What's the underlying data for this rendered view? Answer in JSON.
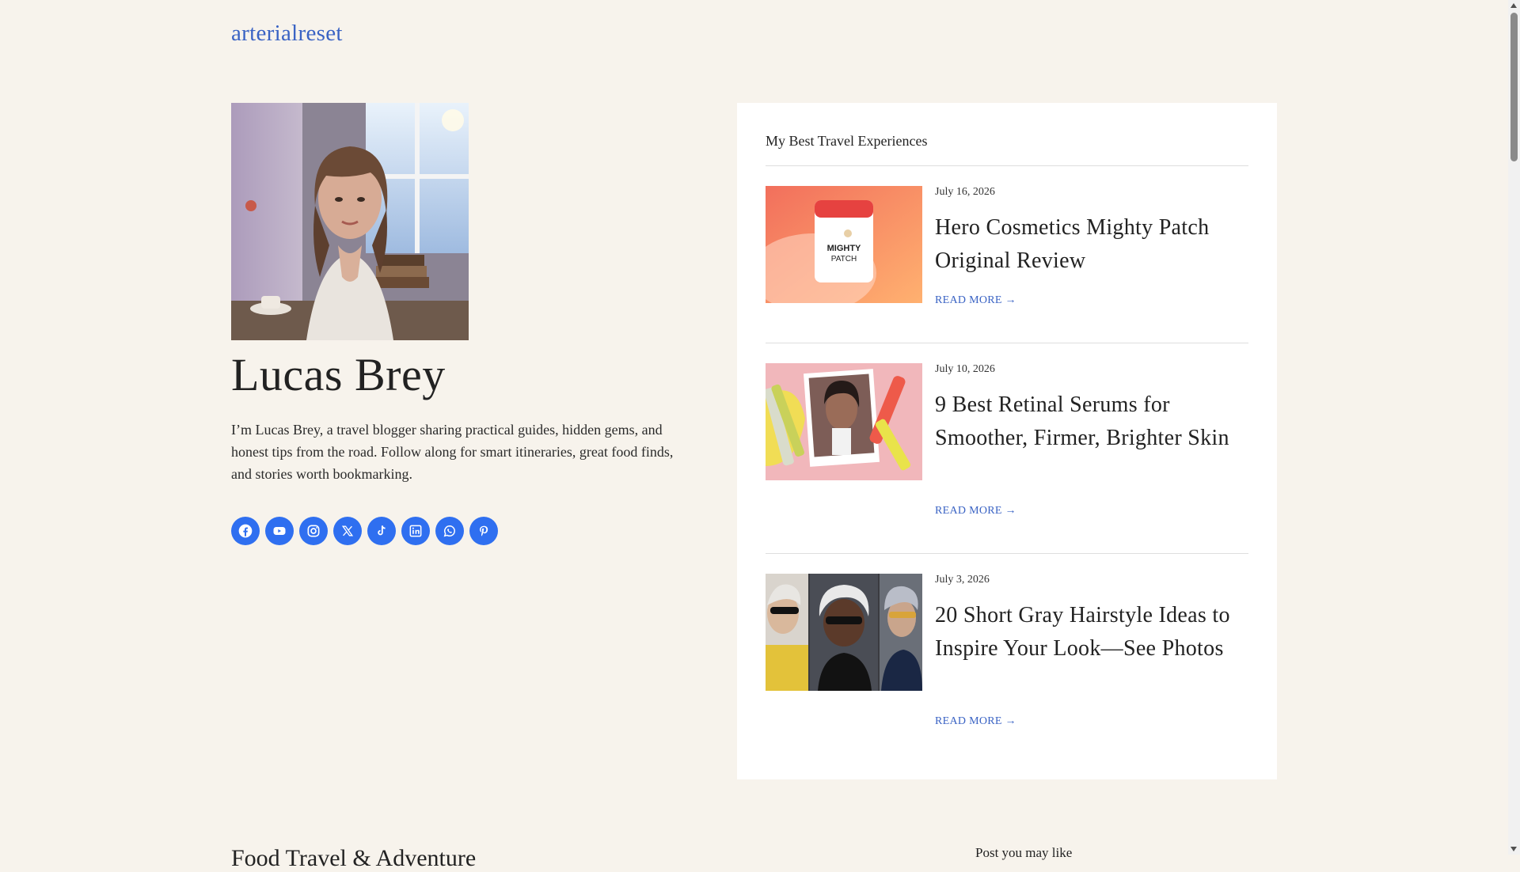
{
  "site": {
    "title": "arterialreset"
  },
  "author": {
    "name": "Lucas Brey",
    "bio": "I’m Lucas Brey, a travel blogger sharing practical guides, hidden gems, and honest tips from the road. Follow along for smart itineraries, great food finds, and stories worth bookmarking."
  },
  "social": [
    {
      "icon": "facebook-icon"
    },
    {
      "icon": "youtube-icon"
    },
    {
      "icon": "instagram-icon"
    },
    {
      "icon": "x-icon"
    },
    {
      "icon": "tiktok-icon"
    },
    {
      "icon": "linkedin-icon"
    },
    {
      "icon": "whatsapp-icon"
    },
    {
      "icon": "pinterest-icon"
    }
  ],
  "sidebar_card": {
    "heading": "My Best Travel Experiences",
    "posts": [
      {
        "date": "July 16, 2026",
        "title": "Hero Cosmetics Mighty Patch Original Review",
        "read_more": "READ MORE →",
        "thumb_text_1": "MIGHTY",
        "thumb_text_2": "PATCH"
      },
      {
        "date": "July 10, 2026",
        "title": "9 Best Retinal Serums for Smoother, Firmer, Brighter Skin",
        "read_more": "READ MORE →"
      },
      {
        "date": "July 3, 2026",
        "title": "20 Short Gray Hairstyle Ideas to Inspire Your Look—See Photos",
        "read_more": "READ MORE →"
      }
    ]
  },
  "bottom": {
    "left_heading": "Food Travel & Adventure",
    "right_heading": "Post you may like"
  },
  "colors": {
    "accent": "#3a63c4",
    "social_bg": "#2f6ff0",
    "page_bg": "#f7f3ec"
  }
}
